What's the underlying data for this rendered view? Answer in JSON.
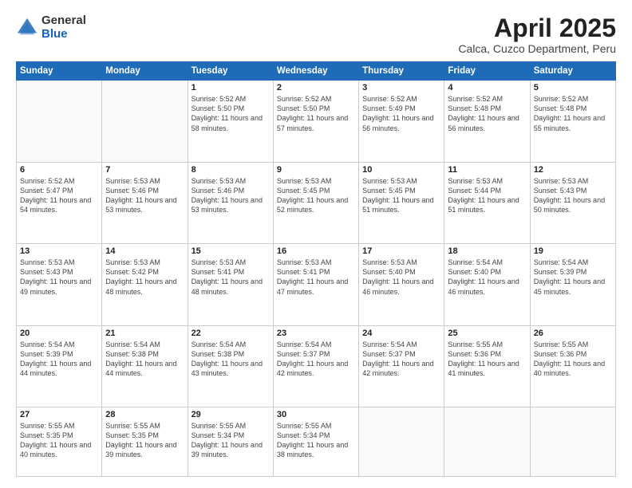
{
  "logo": {
    "general": "General",
    "blue": "Blue"
  },
  "title": {
    "month": "April 2025",
    "location": "Calca, Cuzco Department, Peru"
  },
  "headers": [
    "Sunday",
    "Monday",
    "Tuesday",
    "Wednesday",
    "Thursday",
    "Friday",
    "Saturday"
  ],
  "weeks": [
    [
      {
        "day": "",
        "info": ""
      },
      {
        "day": "",
        "info": ""
      },
      {
        "day": "1",
        "info": "Sunrise: 5:52 AM\nSunset: 5:50 PM\nDaylight: 11 hours and 58 minutes."
      },
      {
        "day": "2",
        "info": "Sunrise: 5:52 AM\nSunset: 5:50 PM\nDaylight: 11 hours and 57 minutes."
      },
      {
        "day": "3",
        "info": "Sunrise: 5:52 AM\nSunset: 5:49 PM\nDaylight: 11 hours and 56 minutes."
      },
      {
        "day": "4",
        "info": "Sunrise: 5:52 AM\nSunset: 5:48 PM\nDaylight: 11 hours and 56 minutes."
      },
      {
        "day": "5",
        "info": "Sunrise: 5:52 AM\nSunset: 5:48 PM\nDaylight: 11 hours and 55 minutes."
      }
    ],
    [
      {
        "day": "6",
        "info": "Sunrise: 5:52 AM\nSunset: 5:47 PM\nDaylight: 11 hours and 54 minutes."
      },
      {
        "day": "7",
        "info": "Sunrise: 5:53 AM\nSunset: 5:46 PM\nDaylight: 11 hours and 53 minutes."
      },
      {
        "day": "8",
        "info": "Sunrise: 5:53 AM\nSunset: 5:46 PM\nDaylight: 11 hours and 53 minutes."
      },
      {
        "day": "9",
        "info": "Sunrise: 5:53 AM\nSunset: 5:45 PM\nDaylight: 11 hours and 52 minutes."
      },
      {
        "day": "10",
        "info": "Sunrise: 5:53 AM\nSunset: 5:45 PM\nDaylight: 11 hours and 51 minutes."
      },
      {
        "day": "11",
        "info": "Sunrise: 5:53 AM\nSunset: 5:44 PM\nDaylight: 11 hours and 51 minutes."
      },
      {
        "day": "12",
        "info": "Sunrise: 5:53 AM\nSunset: 5:43 PM\nDaylight: 11 hours and 50 minutes."
      }
    ],
    [
      {
        "day": "13",
        "info": "Sunrise: 5:53 AM\nSunset: 5:43 PM\nDaylight: 11 hours and 49 minutes."
      },
      {
        "day": "14",
        "info": "Sunrise: 5:53 AM\nSunset: 5:42 PM\nDaylight: 11 hours and 48 minutes."
      },
      {
        "day": "15",
        "info": "Sunrise: 5:53 AM\nSunset: 5:41 PM\nDaylight: 11 hours and 48 minutes."
      },
      {
        "day": "16",
        "info": "Sunrise: 5:53 AM\nSunset: 5:41 PM\nDaylight: 11 hours and 47 minutes."
      },
      {
        "day": "17",
        "info": "Sunrise: 5:53 AM\nSunset: 5:40 PM\nDaylight: 11 hours and 46 minutes."
      },
      {
        "day": "18",
        "info": "Sunrise: 5:54 AM\nSunset: 5:40 PM\nDaylight: 11 hours and 46 minutes."
      },
      {
        "day": "19",
        "info": "Sunrise: 5:54 AM\nSunset: 5:39 PM\nDaylight: 11 hours and 45 minutes."
      }
    ],
    [
      {
        "day": "20",
        "info": "Sunrise: 5:54 AM\nSunset: 5:39 PM\nDaylight: 11 hours and 44 minutes."
      },
      {
        "day": "21",
        "info": "Sunrise: 5:54 AM\nSunset: 5:38 PM\nDaylight: 11 hours and 44 minutes."
      },
      {
        "day": "22",
        "info": "Sunrise: 5:54 AM\nSunset: 5:38 PM\nDaylight: 11 hours and 43 minutes."
      },
      {
        "day": "23",
        "info": "Sunrise: 5:54 AM\nSunset: 5:37 PM\nDaylight: 11 hours and 42 minutes."
      },
      {
        "day": "24",
        "info": "Sunrise: 5:54 AM\nSunset: 5:37 PM\nDaylight: 11 hours and 42 minutes."
      },
      {
        "day": "25",
        "info": "Sunrise: 5:55 AM\nSunset: 5:36 PM\nDaylight: 11 hours and 41 minutes."
      },
      {
        "day": "26",
        "info": "Sunrise: 5:55 AM\nSunset: 5:36 PM\nDaylight: 11 hours and 40 minutes."
      }
    ],
    [
      {
        "day": "27",
        "info": "Sunrise: 5:55 AM\nSunset: 5:35 PM\nDaylight: 11 hours and 40 minutes."
      },
      {
        "day": "28",
        "info": "Sunrise: 5:55 AM\nSunset: 5:35 PM\nDaylight: 11 hours and 39 minutes."
      },
      {
        "day": "29",
        "info": "Sunrise: 5:55 AM\nSunset: 5:34 PM\nDaylight: 11 hours and 39 minutes."
      },
      {
        "day": "30",
        "info": "Sunrise: 5:55 AM\nSunset: 5:34 PM\nDaylight: 11 hours and 38 minutes."
      },
      {
        "day": "",
        "info": ""
      },
      {
        "day": "",
        "info": ""
      },
      {
        "day": "",
        "info": ""
      }
    ]
  ]
}
